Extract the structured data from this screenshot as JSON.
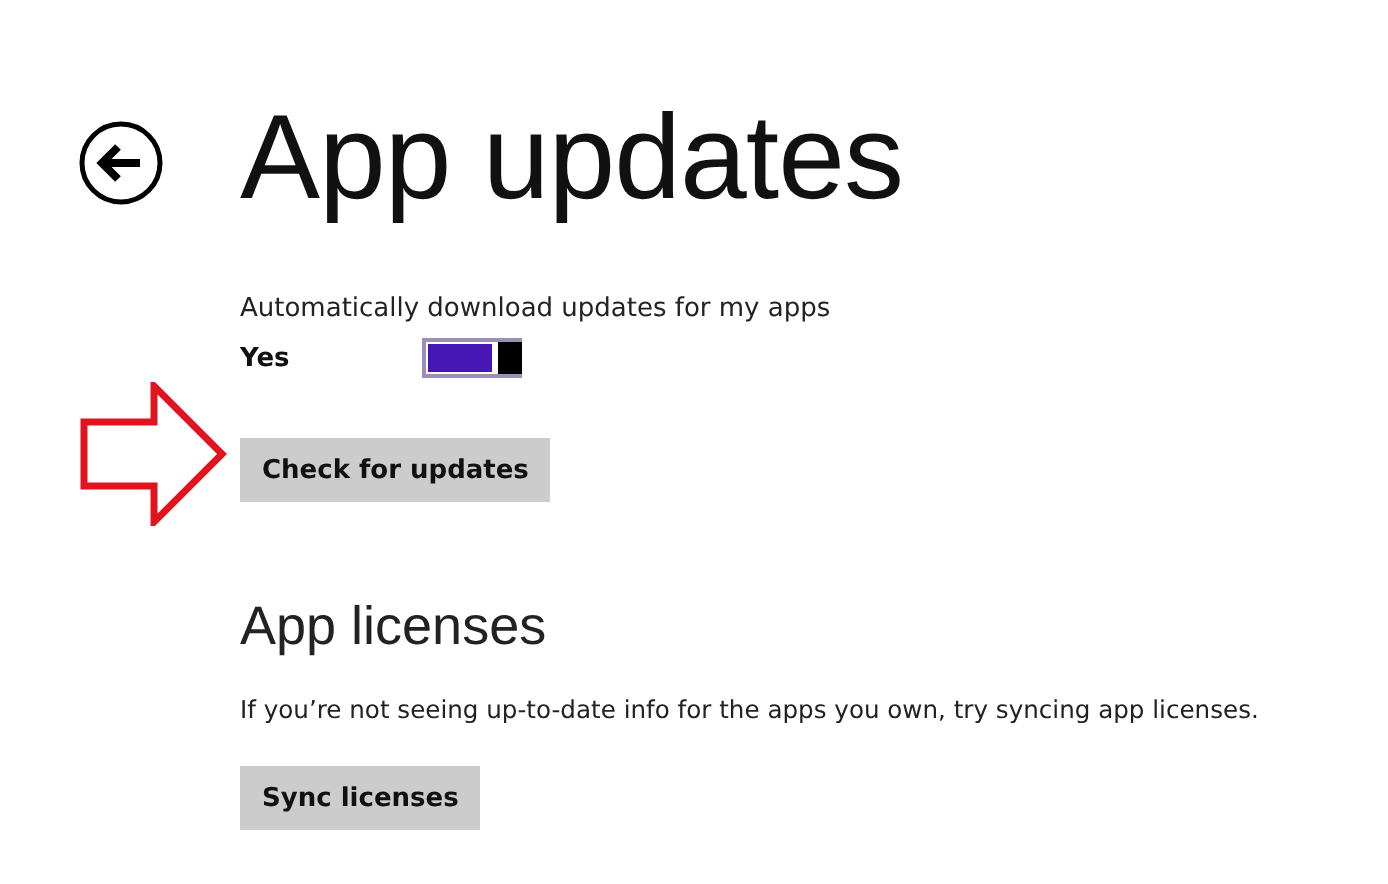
{
  "title": "App updates",
  "auto_update": {
    "label": "Automatically download updates for my apps",
    "value": "Yes",
    "on": true
  },
  "check_button": "Check for updates",
  "licenses": {
    "heading": "App licenses",
    "text": "If you’re not seeing up-to-date info for the apps you own, try syncing app licenses.",
    "button": "Sync licenses"
  }
}
